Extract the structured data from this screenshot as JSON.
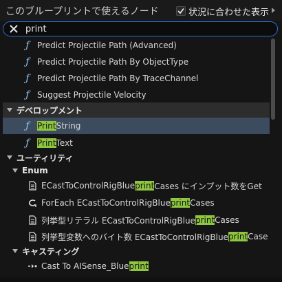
{
  "header": {
    "title": "このブループリントで使えるノード",
    "context_sensitive_label": "状況に合わせた表示",
    "context_sensitive_checked": true
  },
  "search": {
    "value": "print",
    "placeholder": ""
  },
  "colors": {
    "accent": "#2f6fd8",
    "highlight": "#8ec63f",
    "function_icon": "#8ec5f7",
    "selected_row": "#3d4b5e"
  },
  "results": {
    "top_items": [
      {
        "label": "Predict Projectile Path (Advanced)",
        "icon": "function-icon"
      },
      {
        "label": "Predict Projectile Path By ObjectType",
        "icon": "function-icon"
      },
      {
        "label": "Predict Projectile Path By TraceChannel",
        "icon": "function-icon"
      },
      {
        "label": "Suggest Projectile Velocity",
        "icon": "function-icon"
      }
    ],
    "dev_category": "デベロップメント",
    "dev_items": [
      {
        "match": "Print",
        "rest": " String",
        "selected": true,
        "icon": "function-icon"
      },
      {
        "match": "Print",
        "rest": " Text",
        "selected": false,
        "icon": "function-icon"
      }
    ],
    "utility_category": "ユーティリティ",
    "enum_category": "Enum",
    "enum_items": [
      {
        "pre": "ECastToControlRigBlue",
        "match": "print",
        "post": "Cases にインプット数をGet",
        "icon": "document-icon"
      },
      {
        "pre": "ForEach ECastToControlRigBlue",
        "match": "print",
        "post": "Cases",
        "icon": "loop-icon"
      },
      {
        "pre": "列挙型リテラル ECastToControlRigBlue",
        "match": "print",
        "post": "Cases",
        "icon": "document-icon"
      },
      {
        "pre": "列挙型変数へのバイト数 ECastToControlRigBlue",
        "match": "print",
        "post": "Case",
        "icon": "document-icon"
      }
    ],
    "casting_category": "キャスティング",
    "casting_items": [
      {
        "pre": "Cast To AISense_Blue",
        "match": "print",
        "post": "",
        "icon": "cast-icon"
      }
    ]
  }
}
